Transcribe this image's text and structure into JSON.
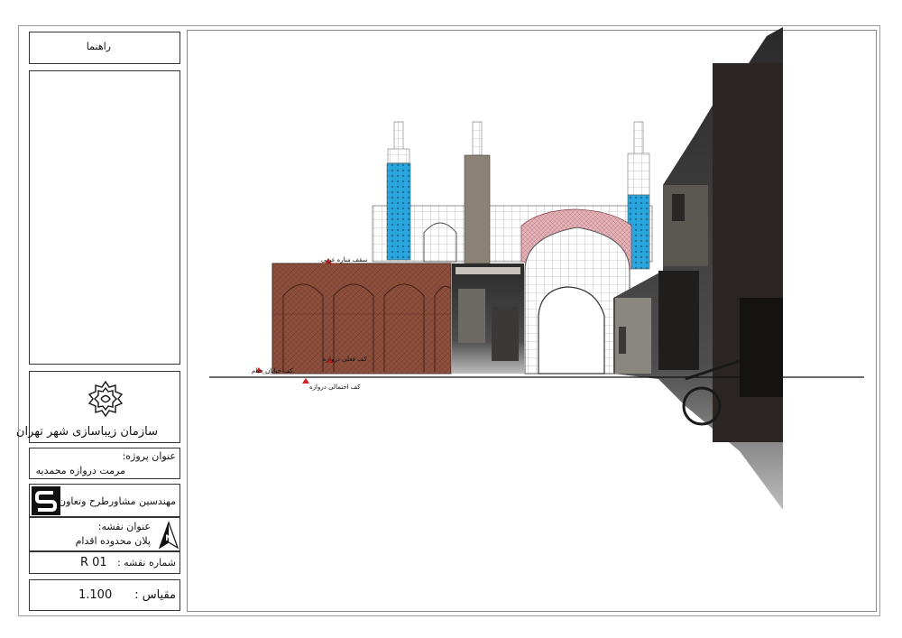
{
  "sidebar": {
    "guide_title": "راهنما",
    "org_name": "سازمان زیباسازی شهر تهران",
    "project_label": "عنوان پروژه:",
    "project_name": "مرمت دروازه محمدیه",
    "consultant_name": "مهندسین مشاورطرح وتعاون",
    "map_title_label": "عنوان نقشه:",
    "map_title": "پلان محدوده اقدام",
    "sheet_number_label": "شماره نقشه :",
    "sheet_number": "R 01",
    "scale_label": "مقیاس :",
    "scale_value": "1.100",
    "north_letter": "N"
  },
  "drawing": {
    "levels": [
      {
        "label": "سقف مناره غربی"
      },
      {
        "label": "کف فعلی دروازه"
      },
      {
        "label": "کف خیابان خیام"
      },
      {
        "label": "کف احتمالی دروازه"
      }
    ]
  },
  "colors": {
    "brick": "#8a4d3c",
    "tile_blue": "#29a6de",
    "pink_hatch": "#d99aa2",
    "sheet_border": "#9a9a9a"
  }
}
